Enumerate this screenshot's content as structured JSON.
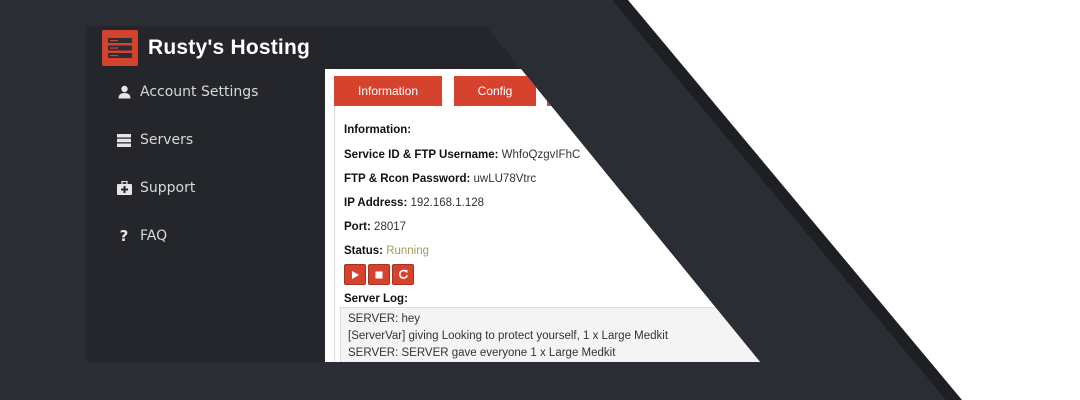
{
  "app": {
    "title": "Rusty's Hosting"
  },
  "sidebar": {
    "items": [
      {
        "label": "Account Settings",
        "icon": "user-icon"
      },
      {
        "label": "Servers",
        "icon": "server-icon"
      },
      {
        "label": "Support",
        "icon": "medkit-icon"
      },
      {
        "label": "FAQ",
        "icon": "question-icon"
      }
    ]
  },
  "tabs": [
    {
      "label": "Information"
    },
    {
      "label": "Config"
    },
    {
      "label": ""
    }
  ],
  "info": {
    "heading": "Information:",
    "service_id_label": "Service ID & FTP Username:",
    "service_id_value": "WhfoQzgvIFhC",
    "password_label": "FTP & Rcon Password:",
    "password_value": "uwLU78Vtrc",
    "ip_label": "IP Address:",
    "ip_value": "192.168.1.128",
    "port_label": "Port:",
    "port_value": "28017",
    "status_label": "Status:",
    "status_value": "Running"
  },
  "controls": [
    "play-icon",
    "stop-icon",
    "restart-icon"
  ],
  "log": {
    "title": "Server Log:",
    "lines": [
      "SERVER: hey",
      "[ServerVar] giving Looking to protect yourself, 1 x Large Medkit",
      "SERVER: SERVER gave everyone 1 x Large Medkit"
    ]
  },
  "colors": {
    "accent": "#d5432e",
    "background_dark": "#2a2d33",
    "status_running": "#a39b5a"
  }
}
